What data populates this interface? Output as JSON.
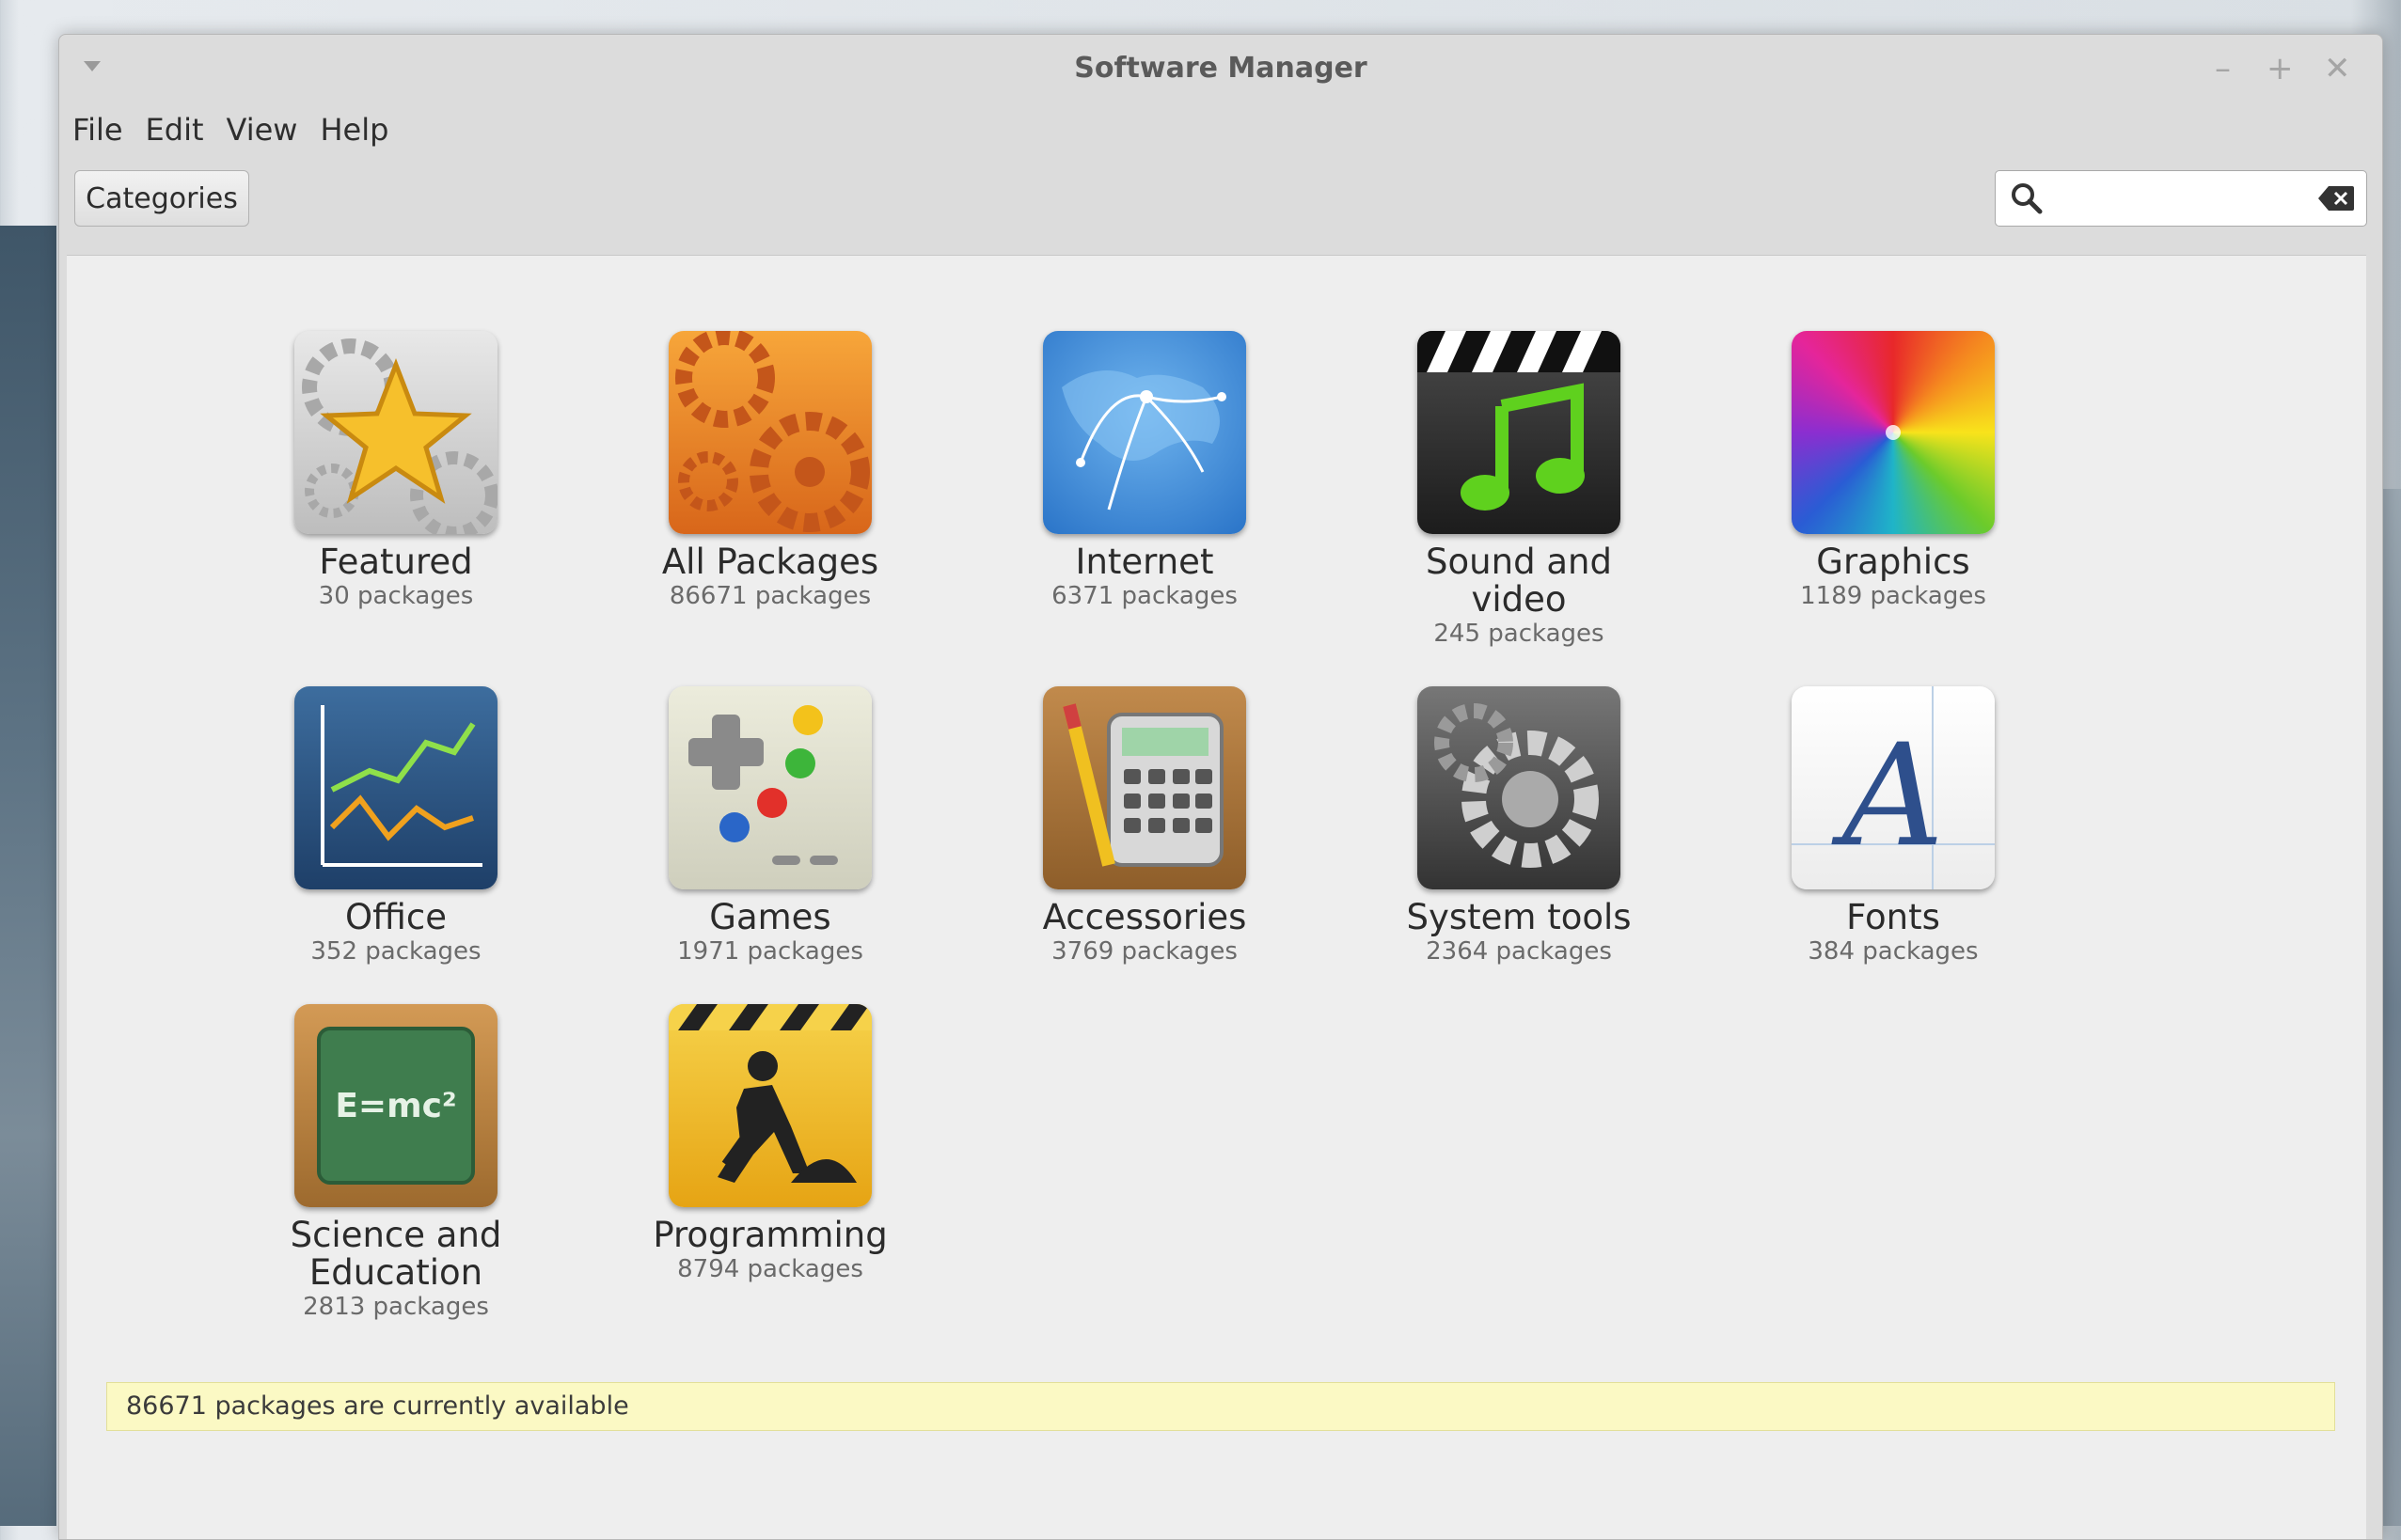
{
  "window": {
    "title": "Software Manager"
  },
  "menubar": {
    "items": [
      "File",
      "Edit",
      "View",
      "Help"
    ]
  },
  "toolbar": {
    "categories_label": "Categories",
    "search_value": ""
  },
  "categories": [
    {
      "name": "Featured",
      "count": "30 packages",
      "icon": "featured-star-icon"
    },
    {
      "name": "All Packages",
      "count": "86671 packages",
      "icon": "all-packages-gears-icon"
    },
    {
      "name": "Internet",
      "count": "6371 packages",
      "icon": "internet-globe-icon"
    },
    {
      "name": "Sound and video",
      "count": "245 packages",
      "icon": "sound-video-clapper-icon"
    },
    {
      "name": "Graphics",
      "count": "1189 packages",
      "icon": "graphics-color-wheel-icon"
    },
    {
      "name": "Office",
      "count": "352 packages",
      "icon": "office-chart-icon"
    },
    {
      "name": "Games",
      "count": "1971 packages",
      "icon": "games-gamepad-icon"
    },
    {
      "name": "Accessories",
      "count": "3769 packages",
      "icon": "accessories-calculator-icon"
    },
    {
      "name": "System tools",
      "count": "2364 packages",
      "icon": "system-tools-gear-icon"
    },
    {
      "name": "Fonts",
      "count": "384 packages",
      "icon": "fonts-letter-icon"
    },
    {
      "name": "Science and Education",
      "count": "2813 packages",
      "icon": "science-chalkboard-icon"
    },
    {
      "name": "Programming",
      "count": "8794 packages",
      "icon": "programming-worker-icon"
    }
  ],
  "status": {
    "text": "86671 packages are currently available"
  },
  "icon_glyphs": {
    "fonts_letter": "A",
    "science_formula": "E=mc²"
  }
}
